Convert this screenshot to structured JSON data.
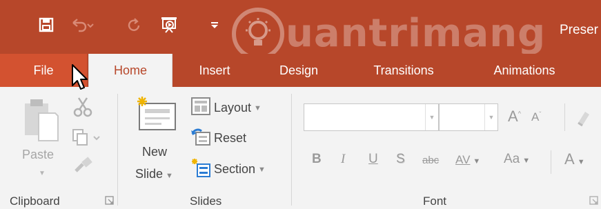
{
  "colors": {
    "accent": "#b7472a",
    "file_tab": "#d35230",
    "ribbon_bg": "#f3f3f3"
  },
  "qat": {
    "save_icon": "save-icon",
    "undo_icon": "undo-icon",
    "redo_icon": "repeat-icon",
    "present_icon": "start-from-beginning-icon",
    "customize_icon": "customize-qat-icon"
  },
  "watermark": {
    "text": "uantrimang"
  },
  "document_title": "Preser",
  "tabs": {
    "file": "File",
    "home": "Home",
    "insert": "Insert",
    "design": "Design",
    "transitions": "Transitions",
    "animations": "Animations"
  },
  "clipboard": {
    "paste_label": "Paste",
    "group_label": "Clipboard"
  },
  "slides": {
    "new_label_line1": "New",
    "new_label_line2": "Slide",
    "layout_label": "Layout",
    "reset_label": "Reset",
    "section_label": "Section",
    "group_label": "Slides"
  },
  "font": {
    "group_label": "Font",
    "bold": "B",
    "italic": "I",
    "underline": "U",
    "shadow": "S",
    "strikethrough": "abc",
    "spacing": "AV",
    "change_case": "Aa",
    "font_color": "A",
    "grow": "A",
    "shrink": "A"
  }
}
